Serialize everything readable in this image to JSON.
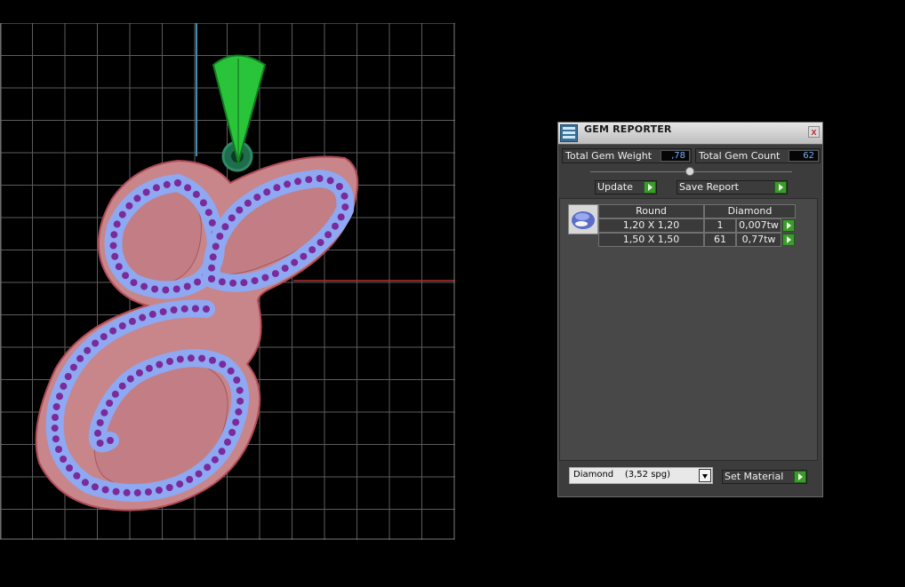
{
  "panel": {
    "title": "GEM REPORTER",
    "close_label": "x",
    "total_weight_label": "Total Gem Weight",
    "total_weight_value": ",78",
    "total_count_label": "Total Gem Count",
    "total_count_value": "62",
    "update_label": "Update",
    "save_report_label": "Save Report",
    "table": {
      "headers": [
        "Round",
        "Diamond"
      ],
      "rows": [
        {
          "size": "1,20 X 1,20",
          "count": "1",
          "weight": "0,007tw"
        },
        {
          "size": "1,50 X 1,50",
          "count": "61",
          "weight": "0,77tw"
        }
      ]
    },
    "material_selected": "Diamond    (3,52 spg)",
    "set_material_label": "Set Material"
  },
  "colors": {
    "accent_green": "#3e9a2e",
    "value_text": "#6fb1ff",
    "metal": "#c47a7a",
    "gem_purple": "#7a2a9a",
    "pave": "#8ea8f2"
  }
}
